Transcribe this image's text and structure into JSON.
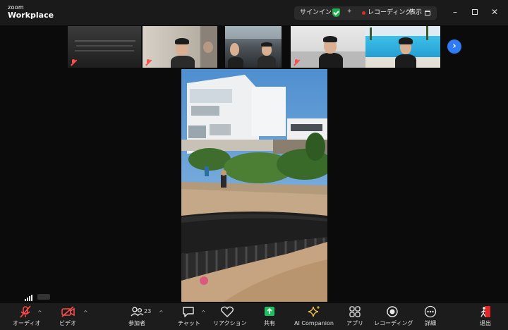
{
  "app": {
    "brand_small": "zoom",
    "brand_large": "Workplace"
  },
  "title_bar": {
    "sign_in": "サインイン",
    "recording": "レコーディング",
    "view": "表示",
    "icons": [
      "shield-check-icon",
      "sparkle-icon",
      "recording-dot-icon",
      "view-grid-icon"
    ],
    "window_controls": [
      "minimize-icon",
      "maximize-icon",
      "close-icon"
    ]
  },
  "thumbnails": {
    "count_visible": 5,
    "next_icon": "chevron-right-icon"
  },
  "toolbar": {
    "audio": "オーディオ",
    "video": "ビデオ",
    "participants": "参加者",
    "participant_count": "23",
    "chat": "チャット",
    "reactions": "リアクション",
    "share": "共有",
    "ai_companion": "AI Companion",
    "apps": "アプリ",
    "recording": "レコーディング",
    "more": "詳細",
    "leave": "退出"
  },
  "colors": {
    "accent_blue": "#2f7bf3",
    "share_green": "#1fbf5f",
    "alert_red": "#ff4d4d",
    "leave_red": "#e02828",
    "secure_green": "#1fae4d"
  }
}
